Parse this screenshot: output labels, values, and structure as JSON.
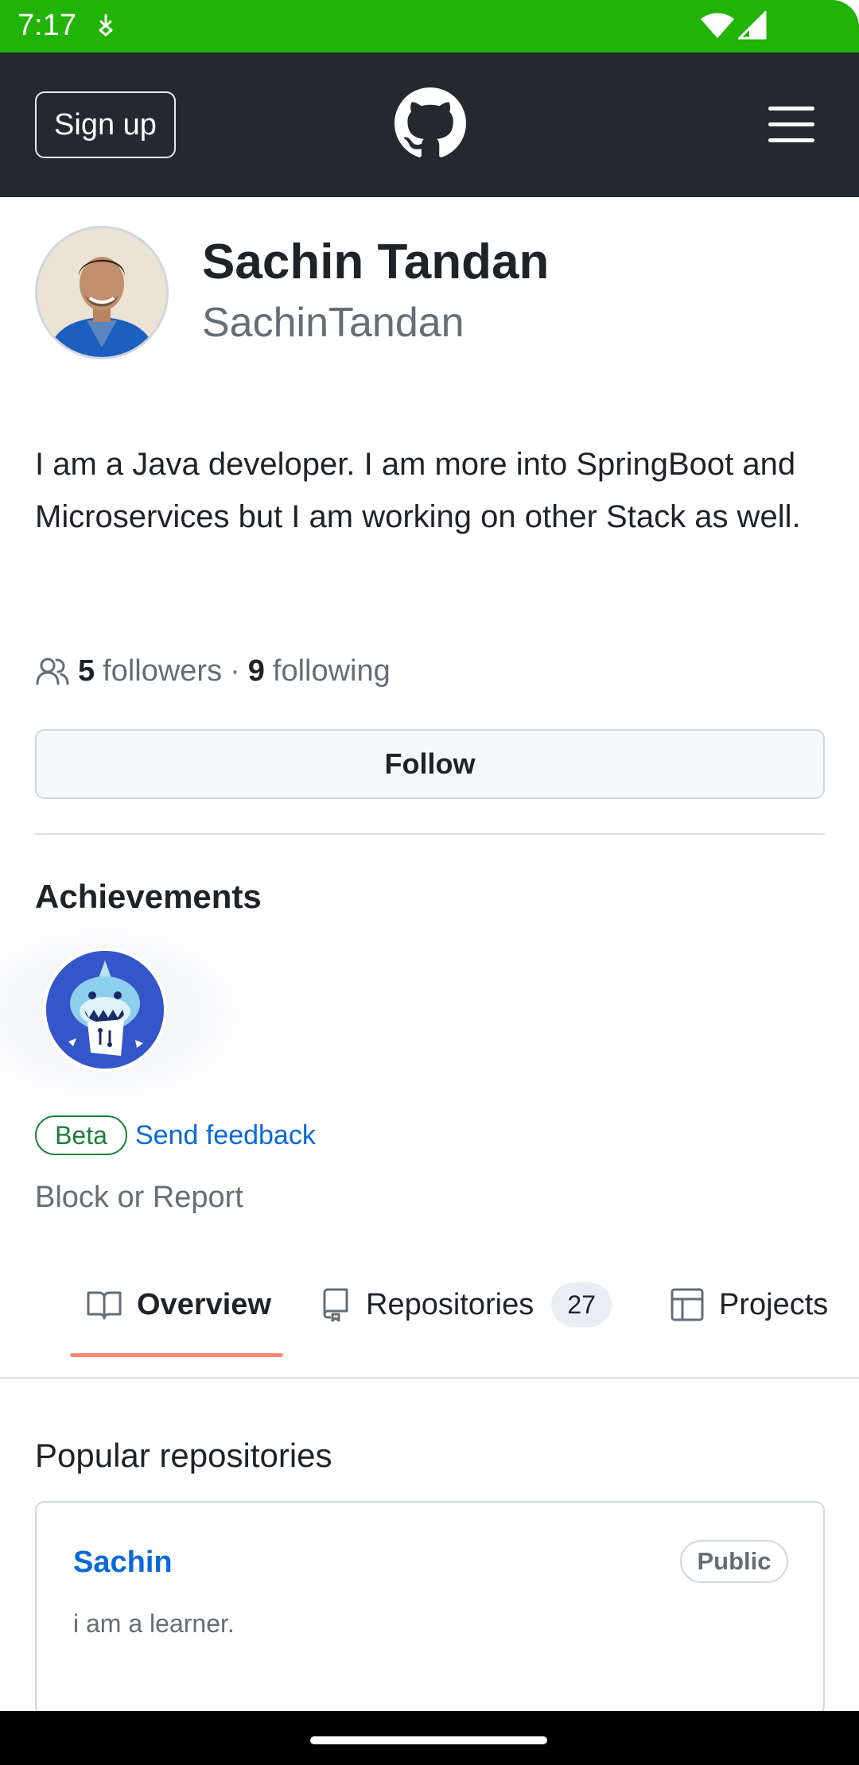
{
  "status_bar": {
    "time": "7:17"
  },
  "header": {
    "signup_label": "Sign up"
  },
  "profile": {
    "name": "Sachin Tandan",
    "login": "SachinTandan",
    "bio": "I am a Java developer. I am more into SpringBoot and Microservices but I am working on other Stack as well.",
    "followers_count": "5",
    "followers_label": "followers",
    "separator": "·",
    "following_count": "9",
    "following_label": "following",
    "follow_button": "Follow"
  },
  "achievements": {
    "title": "Achievements",
    "beta_label": "Beta",
    "feedback_link": "Send feedback"
  },
  "block_report": "Block or Report",
  "tabs": [
    {
      "label": "Overview",
      "icon": "book-icon",
      "selected": true
    },
    {
      "label": "Repositories",
      "icon": "repo-icon",
      "count": "27"
    },
    {
      "label": "Projects",
      "icon": "table-icon"
    }
  ],
  "popular": {
    "title": "Popular repositories",
    "repos": [
      {
        "name": "Sachin",
        "visibility": "Public",
        "description": "i am a learner."
      }
    ]
  },
  "colors": {
    "status_bar": "#21b406",
    "header": "#24292f",
    "link": "#0969da",
    "beta": "#1a7f37",
    "tab_underline": "#fd8c73"
  }
}
